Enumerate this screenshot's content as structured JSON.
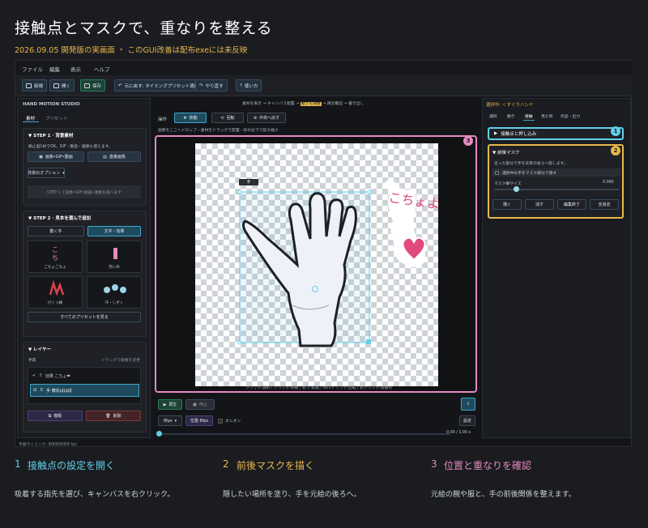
{
  "header": {
    "title": "接触点とマスクで、重なりを整える",
    "subtitle": "2026.09.05 開発版の実画面 ・ このGUI改善は配布exeには未反映"
  },
  "menu": [
    "ファイル",
    "編集",
    "表示",
    "ヘルプ"
  ],
  "toolbar": {
    "new": "新規",
    "open": "開く",
    "save": "保存",
    "undo": "元に戻す: タイミングプリセット適用",
    "redo": "やり直す",
    "help": "使い方"
  },
  "left": {
    "app_name": "HAND MOTION STUDIO",
    "tabs": [
      "素材",
      "プリセット"
    ],
    "step1": {
      "title": "STEP 1 · 背景素材",
      "hint": "静止画1枚でOK。GIF・動画・連番も使えます。",
      "btn_image": "画像•GIF•動画",
      "btn_seq": "連番画像",
      "options": "背景のオプション",
      "placeholder": "STEP 1 で画像•GIF•動画•連番を選べます"
    },
    "step2": {
      "title": "STEP 2 · 見本を選んで追加",
      "tab_hand": "動く手",
      "tab_text": "文字・効果",
      "cards": [
        "ごちょごちょ",
        "笑い声",
        "ぴくっ線",
        "汗・しずく"
      ],
      "see_all": "すべてのプリセットを見る"
    },
    "layers": {
      "title": "レイヤー",
      "order": "手前",
      "hint": "ドラッグで順番を変更",
      "items": [
        "効果 こちょ❤",
        "手 微先ばはぼ"
      ],
      "duplicate": "複製",
      "delete": "削除"
    }
  },
  "center": {
    "workflow": [
      "素材を表示",
      "キャンバス配置",
      "動きを調整",
      "再生確認",
      "書き出し"
    ],
    "op_label": "操作",
    "op_move": "移動",
    "op_rotate": "回転",
    "op_center": "中央へ戻す",
    "hint": "画像をここへドロップ・素材をドラッグで配置・枠の右下で拡大縮小",
    "hand_tag": "手",
    "sticker": "こちょよ",
    "canvas_hint": "クリック:選択 / ドラッグ:移動 / 右下:拡縮 / Alt+ドラッグ:回転 / 右クリック:接触点",
    "play": "再生",
    "stop": "停止",
    "export_icon": "書き出し",
    "fps": "8fps",
    "pos_label": "位置 8fps",
    "onion": "オニオン",
    "settings": "設定",
    "time": "0.00 / 1.00 s"
  },
  "right": {
    "selected": "選択中: くすぐりハンド",
    "tabs": [
      "選択",
      "動き",
      "接触",
      "見た目",
      "作品・出力"
    ],
    "contact": "接触点と押し込み",
    "mask_title": "前後マスク",
    "mask_hint": "塗った部分で手を背景の後ろへ隠します。",
    "mask_check": "選択中の手をマスク部分で隠す",
    "mask_size_label": "マスク筆サイズ",
    "mask_size_value": "0.060",
    "btn_draw": "描く",
    "btn_erase": "消す",
    "btn_done": "編集終了",
    "btn_clear": "全消去"
  },
  "status": "手順タイミング: 8/8/8/8/8/8 fps",
  "steps": [
    {
      "num": "1",
      "title": "接触点の設定を開く",
      "desc": "吸着する指先を選び、キャンバスを右クリック。",
      "color": "#5fd0e8"
    },
    {
      "num": "2",
      "title": "前後マスクを描く",
      "desc": "隠したい場所を塗り、手を元絵の後ろへ。",
      "color": "#e8b84b"
    },
    {
      "num": "3",
      "title": "位置と重なりを確認",
      "desc": "元絵の腕や服と、手の前後関係を整えます。",
      "color": "#e58ac0"
    }
  ],
  "badges": {
    "b1": "1",
    "b2": "2",
    "b3": "3"
  },
  "colors": {
    "cyan": "#5fd0e8",
    "yellow": "#e8b84b",
    "pink": "#e58ac0"
  }
}
